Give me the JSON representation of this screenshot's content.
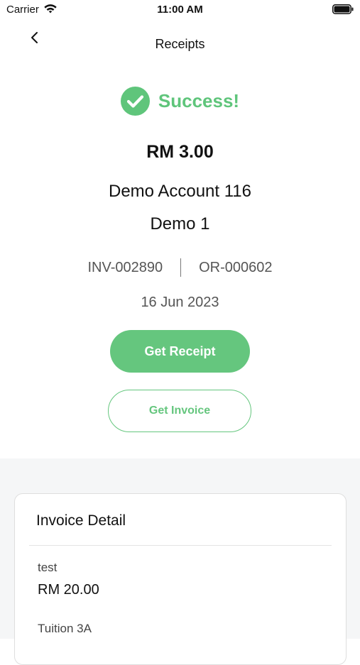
{
  "status_bar": {
    "carrier": "Carrier",
    "time": "11:00 AM"
  },
  "nav": {
    "title": "Receipts"
  },
  "result": {
    "status": "Success!",
    "amount": "RM 3.00",
    "account": "Demo Account 116",
    "student": "Demo 1",
    "invoice_no": "INV-002890",
    "receipt_no": "OR-000602",
    "date": "16 Jun 2023"
  },
  "buttons": {
    "get_receipt": "Get Receipt",
    "get_invoice": "Get Invoice"
  },
  "invoice_detail": {
    "title": "Invoice Detail",
    "items": [
      {
        "name": "test",
        "amount": "RM 20.00"
      },
      {
        "name": "Tuition 3A"
      }
    ]
  },
  "colors": {
    "accent": "#65c67e",
    "text": "#111111",
    "muted": "#555555",
    "background_gray": "#f5f6f7"
  },
  "icons": [
    "wifi-icon",
    "battery-icon",
    "back-chevron-icon",
    "check-circle-icon"
  ]
}
